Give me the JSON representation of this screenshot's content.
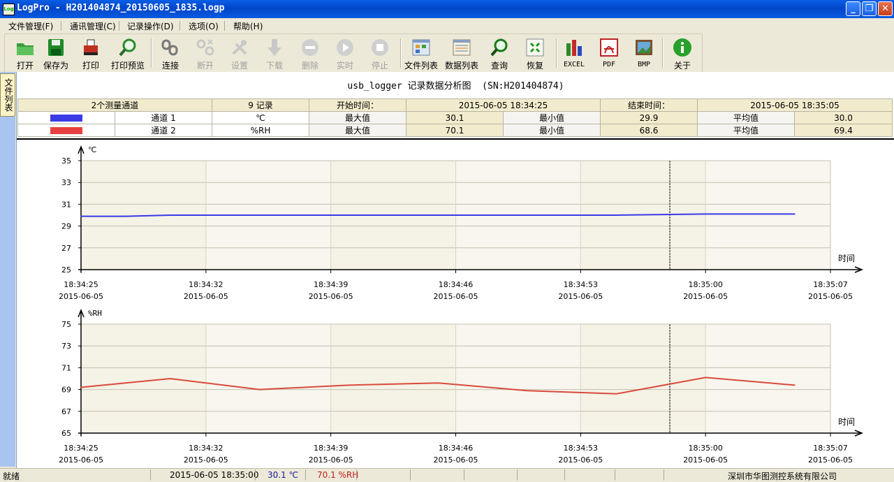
{
  "window": {
    "title": "LogPro - H201404874_20150605_1835.logp",
    "icon_text": "Log"
  },
  "menu": [
    {
      "label": "文件管理(F)"
    },
    {
      "label": "通讯管理(C)"
    },
    {
      "label": "记录操作(D)"
    },
    {
      "label": "选项(O)"
    },
    {
      "label": "帮助(H)"
    }
  ],
  "toolbar": [
    {
      "label": "打开",
      "icon": "folder-open-icon",
      "enabled": true
    },
    {
      "label": "保存为",
      "icon": "save-disk-icon",
      "enabled": true
    },
    {
      "label": "打印",
      "icon": "printer-icon",
      "enabled": true
    },
    {
      "label": "打印预览",
      "icon": "print-preview-icon",
      "enabled": true
    },
    {
      "label": "连接",
      "icon": "connect-chain-icon",
      "enabled": true
    },
    {
      "label": "断开",
      "icon": "disconnect-icon",
      "enabled": false
    },
    {
      "label": "设置",
      "icon": "settings-tools-icon",
      "enabled": false
    },
    {
      "label": "下载",
      "icon": "download-arrow-icon",
      "enabled": false
    },
    {
      "label": "删除",
      "icon": "delete-icon",
      "enabled": false
    },
    {
      "label": "实时",
      "icon": "realtime-play-icon",
      "enabled": false
    },
    {
      "label": "停止",
      "icon": "stop-icon",
      "enabled": false
    },
    {
      "label": "文件列表",
      "icon": "file-list-icon",
      "enabled": true
    },
    {
      "label": "数据列表",
      "icon": "data-list-icon",
      "enabled": true
    },
    {
      "label": "查询",
      "icon": "search-icon",
      "enabled": true
    },
    {
      "label": "恢复",
      "icon": "restore-icon",
      "enabled": true
    },
    {
      "label": "EXCEL",
      "icon": "excel-icon",
      "enabled": true
    },
    {
      "label": "PDF",
      "icon": "pdf-icon",
      "enabled": true
    },
    {
      "label": "BMP",
      "icon": "bmp-icon",
      "enabled": true
    },
    {
      "label": "关于",
      "icon": "about-info-icon",
      "enabled": true
    }
  ],
  "side_tab": {
    "label": "文件列表"
  },
  "report": {
    "title": "usb_logger 记录数据分析图  (SN:H201404874)",
    "channels_label": "2个测量通道",
    "records_label": "9 记录",
    "start_label": "开始时间：",
    "start_value": "2015-06-05 18:34:25",
    "end_label": "结束时间：",
    "end_value": "2015-06-05 18:35:05",
    "max_label": "最大值",
    "min_label": "最小值",
    "avg_label": "平均值",
    "channels": [
      {
        "name": "通道 1",
        "unit": "℃",
        "color": "#3a3ae6",
        "max": "30.1",
        "min": "29.9",
        "avg": "30.0"
      },
      {
        "name": "通道 2",
        "unit": "%RH",
        "color": "#e84040",
        "max": "70.1",
        "min": "68.6",
        "avg": "69.4"
      }
    ]
  },
  "chart_data": [
    {
      "type": "line",
      "ylabel": "℃",
      "xlabel": "时间",
      "ylim": [
        25,
        35
      ],
      "yticks": [
        "35",
        "33",
        "31",
        "29",
        "27",
        "25"
      ],
      "x_tick_times": [
        "18:34:25",
        "18:34:32",
        "18:34:39",
        "18:34:46",
        "18:34:53",
        "18:35:00",
        "18:35:07"
      ],
      "x_tick_dates": [
        "2015-06-05",
        "2015-06-05",
        "2015-06-05",
        "2015-06-05",
        "2015-06-05",
        "2015-06-05",
        "2015-06-05"
      ],
      "x_range": [
        "18:34:25",
        "18:35:07"
      ],
      "cursor_time": "18:34:58",
      "series": [
        {
          "name": "通道 1",
          "color": "#3a3ae6",
          "x": [
            "18:34:25",
            "18:34:27.5",
            "18:34:30",
            "18:34:35",
            "18:34:40",
            "18:34:45",
            "18:34:50",
            "18:34:55",
            "18:35:00",
            "18:35:05"
          ],
          "values": [
            29.9,
            29.9,
            30.0,
            30.0,
            30.0,
            30.0,
            30.0,
            30.0,
            30.1,
            30.1
          ]
        }
      ]
    },
    {
      "type": "line",
      "ylabel": "%RH",
      "xlabel": "时间",
      "ylim": [
        65,
        75
      ],
      "yticks": [
        "75",
        "73",
        "71",
        "69",
        "67",
        "65"
      ],
      "x_tick_times": [
        "18:34:25",
        "18:34:32",
        "18:34:39",
        "18:34:46",
        "18:34:53",
        "18:35:00",
        "18:35:07"
      ],
      "x_tick_dates": [
        "2015-06-05",
        "2015-06-05",
        "2015-06-05",
        "2015-06-05",
        "2015-06-05",
        "2015-06-05",
        "2015-06-05"
      ],
      "x_range": [
        "18:34:25",
        "18:35:07"
      ],
      "cursor_time": "18:34:58",
      "series": [
        {
          "name": "通道 2",
          "color": "#d84a3a",
          "x": [
            "18:34:25",
            "18:34:30",
            "18:34:35",
            "18:34:40",
            "18:34:45",
            "18:34:50",
            "18:34:55",
            "18:35:00",
            "18:35:05"
          ],
          "values": [
            69.2,
            70.0,
            69.0,
            69.4,
            69.6,
            68.9,
            68.6,
            70.1,
            69.4
          ]
        }
      ]
    }
  ],
  "statusbar": {
    "ready": "就绪",
    "time": "2015-06-05 18:35:00",
    "ch1": "30.1 ℃",
    "ch2": "70.1 %RH",
    "company": "深圳市华图测控系统有限公司",
    "ch1_color": "#1a1aa0",
    "ch2_color": "#c02020"
  }
}
